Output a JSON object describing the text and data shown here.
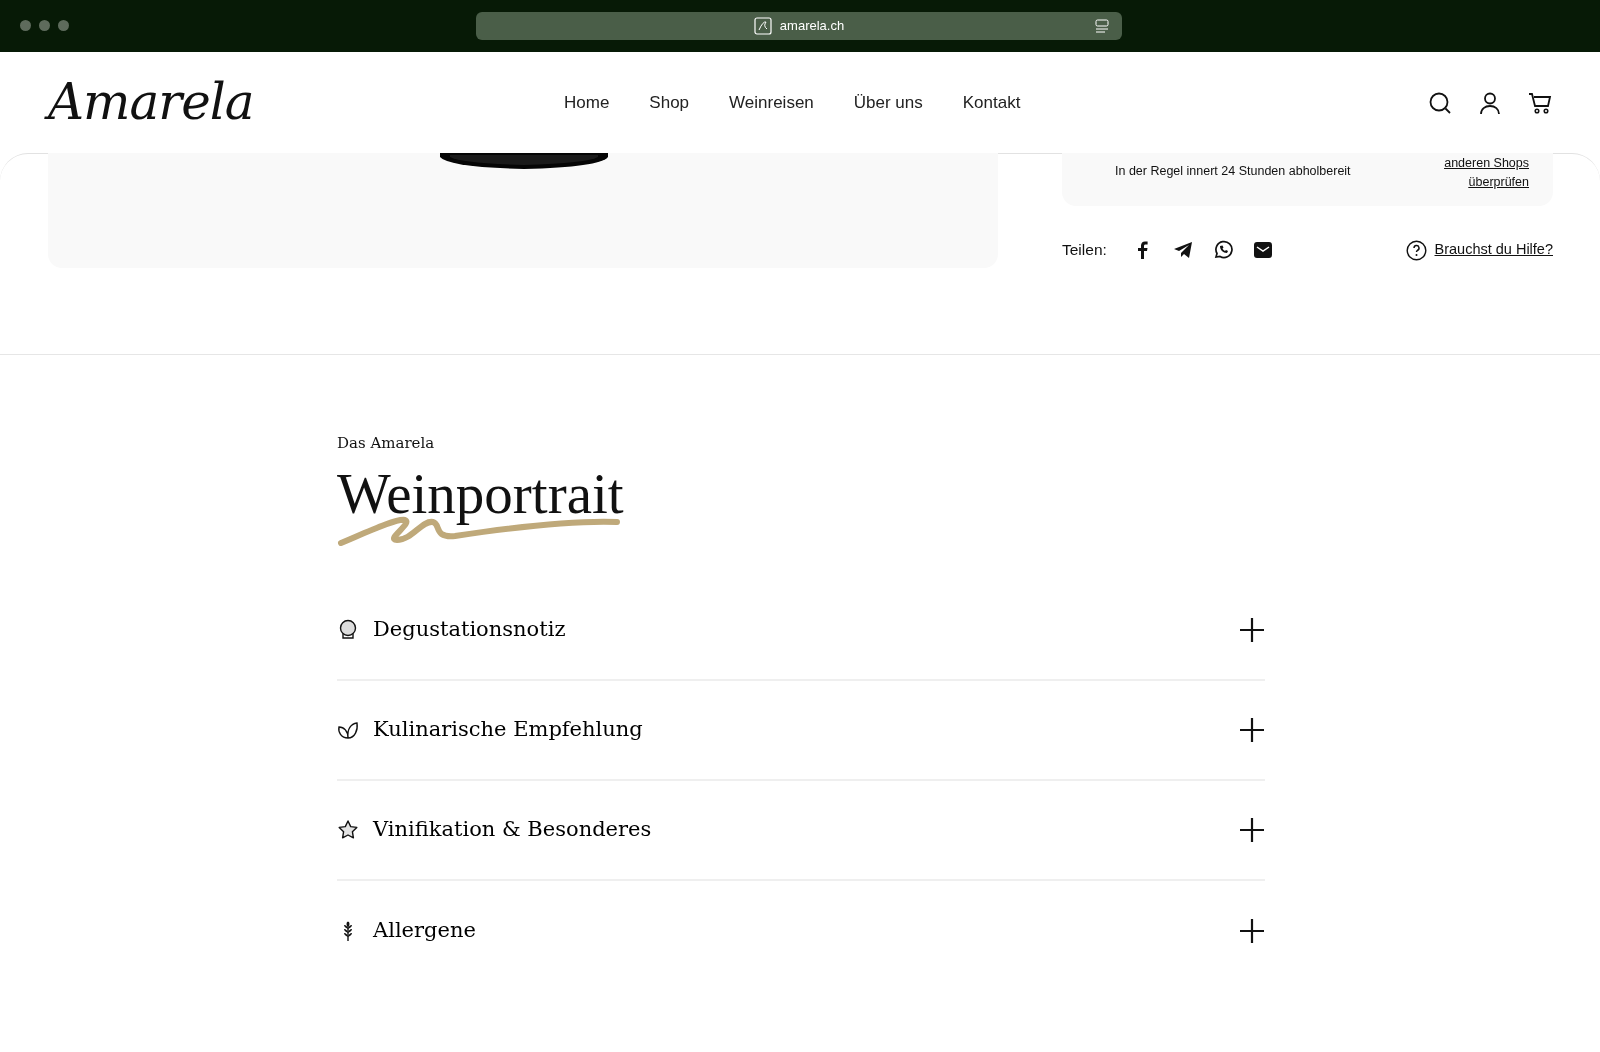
{
  "browser": {
    "url": "amarela.ch"
  },
  "header": {
    "logo": "Amarela",
    "nav": [
      {
        "label": "Home"
      },
      {
        "label": "Shop"
      },
      {
        "label": "Weinreisen"
      },
      {
        "label": "Über uns"
      },
      {
        "label": "Kontakt"
      }
    ]
  },
  "availability": {
    "note": "In der Regel innert 24 Stunden abholbereit",
    "link": [
      "anderen Shops",
      "überprüfen"
    ]
  },
  "share": {
    "label": "Teilen:",
    "help": "Brauchst du Hilfe?"
  },
  "section": {
    "kicker": "Das Amarela",
    "title": "Weinportrait"
  },
  "accordion": [
    {
      "title": "Degustationsnotiz",
      "expanded": false
    },
    {
      "title": "Kulinarische Empfehlung",
      "expanded": false
    },
    {
      "title": "Vinifikation & Besonderes",
      "expanded": false
    },
    {
      "title": "Allergene",
      "expanded": false
    }
  ]
}
